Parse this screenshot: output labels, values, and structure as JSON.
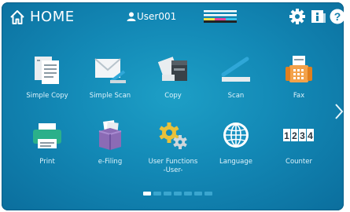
{
  "header": {
    "home_label": "HOME",
    "user_label": "User001",
    "icons": [
      "home-icon",
      "user-icon",
      "toner-status-icon",
      "gear-icon",
      "info-icon",
      "help-icon"
    ]
  },
  "apps": [
    {
      "label": "Simple Copy",
      "icon": "simple-copy-icon"
    },
    {
      "label": "Simple Scan",
      "icon": "simple-scan-icon"
    },
    {
      "label": "Copy",
      "icon": "copy-icon"
    },
    {
      "label": "Scan",
      "icon": "scan-icon"
    },
    {
      "label": "Fax",
      "icon": "fax-icon"
    },
    {
      "label": "Print",
      "icon": "print-icon"
    },
    {
      "label": "e-Filing",
      "icon": "efiling-icon"
    },
    {
      "label": "User Functions\n-User-",
      "icon": "user-functions-icon"
    },
    {
      "label": "Language",
      "icon": "globe-icon"
    },
    {
      "label": "Counter",
      "icon": "counter-icon"
    }
  ],
  "pager": {
    "pages": 7,
    "current": 1
  },
  "counter_glyph": {
    "digits": [
      "1",
      "2",
      "3",
      "4"
    ]
  },
  "colors": {
    "screen": "#1389b6",
    "accent": "#ffffff"
  }
}
